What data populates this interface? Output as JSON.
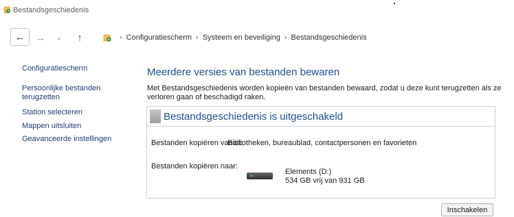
{
  "window": {
    "title": "Bestandsgeschiedenis",
    "icon": "file-history-icon"
  },
  "nav": {
    "back": "←",
    "forward": "→",
    "recent": "⌄",
    "up": "↑",
    "separator": "›",
    "path_icon": "control-panel-icon",
    "breadcrumbs": [
      "Configuratiescherm",
      "Systeem en beveiliging",
      "Bestandsgeschiedenis"
    ]
  },
  "sidebar": {
    "items": [
      {
        "label": "Configuratiescherm"
      },
      {
        "label_line1": "Persoonlijke bestanden",
        "label_line2": "terugzetten"
      },
      {
        "label": "Station selecteren"
      },
      {
        "label": "Mappen uitsluiten"
      },
      {
        "label": "Geavanceerde instellingen"
      }
    ]
  },
  "main": {
    "heading": "Meerdere versies van bestanden bewaren",
    "description_line1": "Met Bestandsgeschiedenis worden kopieën van bestanden bewaard, zodat u deze kunt terugzetten als ze",
    "description_line2": "verloren gaan of beschadigd raken.",
    "status_title": "Bestandsgeschiedenis is uitgeschakeld",
    "copy_from_label": "Bestanden kopiëren vanuit:",
    "copy_from_value": "Bibliotheken, bureaublad, contactpersonen en favorieten",
    "copy_to_label": "Bestanden kopiëren naar:",
    "drive_name": "Elements (D:)",
    "drive_space": "534 GB vrij van 931 GB",
    "enable_button": "Inschakelen"
  },
  "colors": {
    "heading": "#1e4e91",
    "link": "#1f3b70",
    "panel_border": "#c7cfe0",
    "drive_led": "#39d14a"
  }
}
